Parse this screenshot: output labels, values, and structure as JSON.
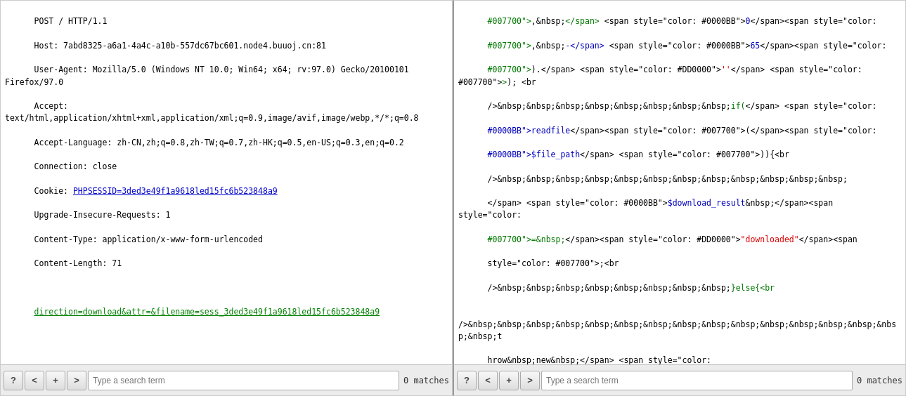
{
  "left_panel": {
    "lines": [
      {
        "text": "POST / HTTP/1.1",
        "type": "plain"
      },
      {
        "text": "Host: 7abd8325-a6a1-4a4c-a10b-557dc67bc601.node4.buuoj.cn:81",
        "type": "plain"
      },
      {
        "text": "User-Agent: Mozilla/5.0 (Windows NT 10.0; Win64; x64; rv:97.0) Gecko/20100101 Firefox/97.0",
        "type": "plain"
      },
      {
        "text": "Accept: text/html,application/xhtml+xml,application/xml;q=0.9,image/avif,image/webp,*/*;q=0.8",
        "type": "plain"
      },
      {
        "text": "Accept-Language: zh-CN,zh;q=0.8,zh-TW;q=0.7,zh-HK;q=0.5,en-US;q=0.3,en;q=0.2",
        "type": "plain"
      },
      {
        "text": "Connection: close",
        "type": "plain"
      },
      {
        "text": "Cookie: PHPSESSID=3ded3e49f1a9618led15fc6b523848a9",
        "type": "link"
      },
      {
        "text": "Upgrade-Insecure-Requests: 1",
        "type": "plain"
      },
      {
        "text": "Content-Type: application/x-www-form-urlencoded",
        "type": "plain"
      },
      {
        "text": "Content-Length: 71",
        "type": "plain"
      },
      {
        "text": "",
        "type": "plain"
      },
      {
        "text": "direction=download&attr=&filename=sess_3ded3e49f1a9618led15fc6b523848a9",
        "type": "green-link"
      }
    ],
    "toolbar": {
      "search_placeholder": "Type a search term",
      "matches": "0 matches"
    }
  },
  "right_panel": {
    "toolbar": {
      "search_placeholder": "Type a search term",
      "matches": "0 matches"
    }
  },
  "buttons": {
    "help": "?",
    "prev": "<",
    "add": "+",
    "next": ">"
  }
}
